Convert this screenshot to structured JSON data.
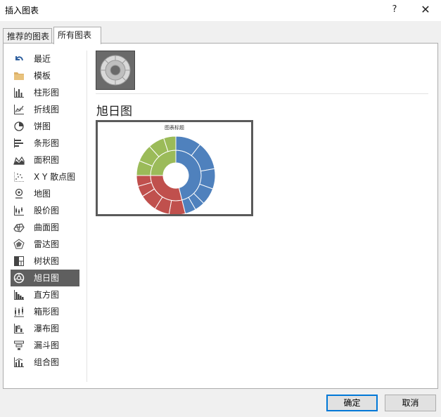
{
  "dialog": {
    "title": "插入图表",
    "help_label": "?",
    "close_label": "✕"
  },
  "tabs": [
    {
      "label": "推荐的图表",
      "active": false
    },
    {
      "label": "所有图表",
      "active": true
    }
  ],
  "sidebar": {
    "items": [
      {
        "label": "最近",
        "icon": "undo-arrow-icon"
      },
      {
        "label": "模板",
        "icon": "folder-icon"
      },
      {
        "label": "柱形图",
        "icon": "column-chart-icon"
      },
      {
        "label": "折线图",
        "icon": "line-chart-icon"
      },
      {
        "label": "饼图",
        "icon": "pie-chart-icon"
      },
      {
        "label": "条形图",
        "icon": "bar-chart-icon"
      },
      {
        "label": "面积图",
        "icon": "area-chart-icon"
      },
      {
        "label": "X Y 散点图",
        "icon": "scatter-chart-icon"
      },
      {
        "label": "地图",
        "icon": "map-pin-icon"
      },
      {
        "label": "股价图",
        "icon": "stock-chart-icon"
      },
      {
        "label": "曲面图",
        "icon": "surface-chart-icon"
      },
      {
        "label": "雷达图",
        "icon": "radar-chart-icon"
      },
      {
        "label": "树状图",
        "icon": "treemap-icon"
      },
      {
        "label": "旭日图",
        "icon": "sunburst-icon",
        "selected": true
      },
      {
        "label": "直方图",
        "icon": "histogram-icon"
      },
      {
        "label": "箱形图",
        "icon": "box-whisker-icon"
      },
      {
        "label": "瀑布图",
        "icon": "waterfall-icon"
      },
      {
        "label": "漏斗图",
        "icon": "funnel-icon"
      },
      {
        "label": "组合图",
        "icon": "combo-chart-icon"
      }
    ]
  },
  "main": {
    "chart_name": "旭日图",
    "preview_title": "图表标题",
    "colors": {
      "blue": "#4f81bd",
      "red": "#c0504d",
      "green": "#9bbb59",
      "selected_bg": "#5f5f5f"
    }
  },
  "buttons": {
    "ok_label": "确定",
    "cancel_label": "取消"
  }
}
